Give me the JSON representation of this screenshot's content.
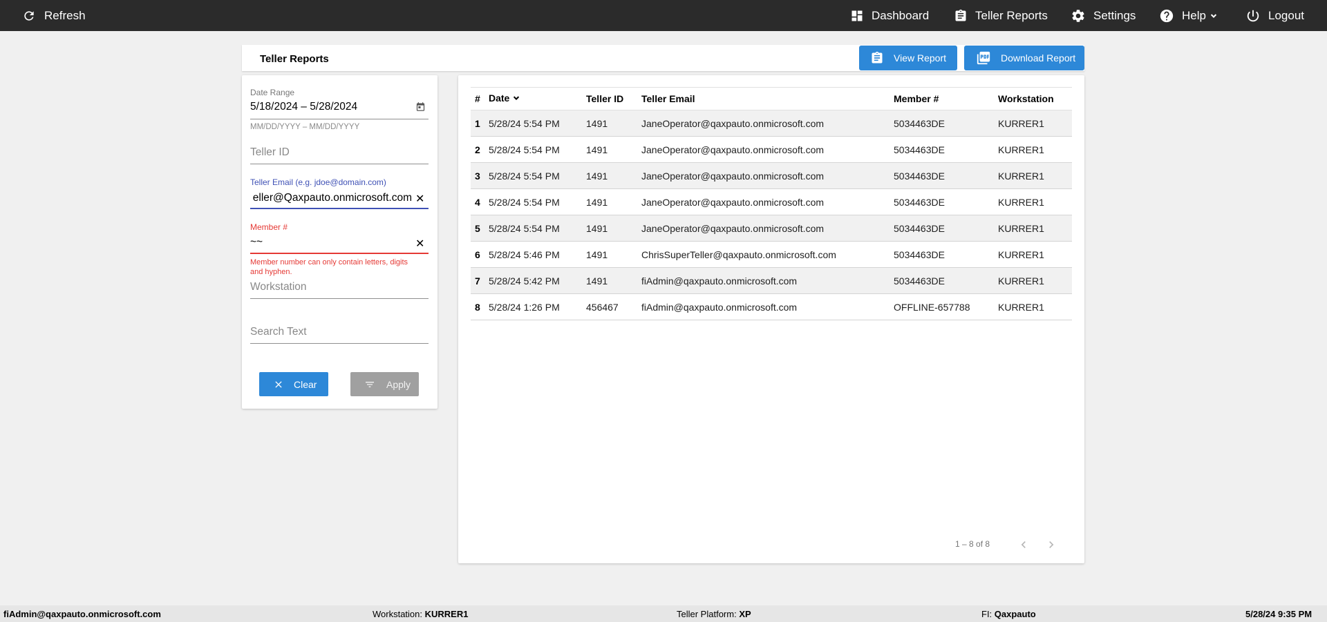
{
  "topbar": {
    "refresh": "Refresh",
    "dashboard": "Dashboard",
    "teller_reports": "Teller Reports",
    "settings": "Settings",
    "help": "Help",
    "logout": "Logout"
  },
  "header": {
    "title": "Teller Reports",
    "view_report": "View Report",
    "download_report": "Download Report"
  },
  "filters": {
    "date_range_label": "Date Range",
    "date_range_value": "5/18/2024 – 5/28/2024",
    "date_range_hint": "MM/DD/YYYY – MM/DD/YYYY",
    "teller_id_placeholder": "Teller ID",
    "teller_email_label": "Teller Email (e.g. jdoe@domain.com)",
    "teller_email_value": "eller@Qaxpauto.onmicrosoft.com",
    "member_label": "Member #",
    "member_value": "~~",
    "member_error": "Member number can only contain letters, digits",
    "member_error_2": "and hyphen.",
    "workstation_placeholder": "Workstation",
    "search_placeholder": "Search Text",
    "clear_button": "Clear",
    "apply_button": "Apply",
    "error_color": "#e53935",
    "focus_color": "#3f51b5"
  },
  "table": {
    "headers": [
      "#",
      "Date",
      "Teller ID",
      "Teller Email",
      "Member #",
      "Workstation"
    ],
    "rows": [
      [
        "1",
        "5/28/24 5:54 PM",
        "1491",
        "JaneOperator@qaxpauto.onmicrosoft.com",
        "5034463DE",
        "KURRER1"
      ],
      [
        "2",
        "5/28/24 5:54 PM",
        "1491",
        "JaneOperator@qaxpauto.onmicrosoft.com",
        "5034463DE",
        "KURRER1"
      ],
      [
        "3",
        "5/28/24 5:54 PM",
        "1491",
        "JaneOperator@qaxpauto.onmicrosoft.com",
        "5034463DE",
        "KURRER1"
      ],
      [
        "4",
        "5/28/24 5:54 PM",
        "1491",
        "JaneOperator@qaxpauto.onmicrosoft.com",
        "5034463DE",
        "KURRER1"
      ],
      [
        "5",
        "5/28/24 5:54 PM",
        "1491",
        "JaneOperator@qaxpauto.onmicrosoft.com",
        "5034463DE",
        "KURRER1"
      ],
      [
        "6",
        "5/28/24 5:46 PM",
        "1491",
        "ChrisSuperTeller@qaxpauto.onmicrosoft.com",
        "5034463DE",
        "KURRER1"
      ],
      [
        "7",
        "5/28/24 5:42 PM",
        "1491",
        "fiAdmin@qaxpauto.onmicrosoft.com",
        "5034463DE",
        "KURRER1"
      ],
      [
        "8",
        "5/28/24 1:26 PM",
        "456467",
        "fiAdmin@qaxpauto.onmicrosoft.com",
        "OFFLINE-657788",
        "KURRER1"
      ]
    ],
    "pager": "1 – 8 of 8"
  },
  "statusbar": {
    "user": "fiAdmin@qaxpauto.onmicrosoft.com",
    "workstation_label": "Workstation: ",
    "workstation_value": "KURRER1",
    "platform_label": "Teller Platform: ",
    "platform_value": "XP",
    "fi_label": "FI: ",
    "fi_value": "Qaxpauto",
    "datetime": "5/28/24 9:35 PM"
  },
  "colors": {
    "topbar_bg": "#2b2b2b",
    "accent": "#2d88d8",
    "disabled": "#a0a0a0"
  }
}
